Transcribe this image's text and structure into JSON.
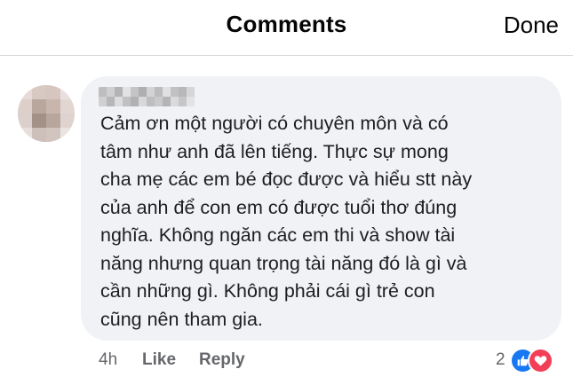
{
  "header": {
    "title": "Comments",
    "done_label": "Done"
  },
  "comment": {
    "text": "Cảm ơn một người có chuyên môn và có\ntâm như anh đã lên tiếng. Thực sự mong\ncha mẹ các em bé đọc được và hiểu stt này\ncủa anh để con em có được tuổi thơ đúng\nnghĩa. Không ngăn các em thi và show tài\nnăng nhưng quan trọng tài năng đó là gì và\ncần những gì. Không phải cái gì trẻ con\ncũng nên tham gia.",
    "time": "4h",
    "like_label": "Like",
    "reply_label": "Reply",
    "reaction_count": "2",
    "reaction_icons": [
      "like-reaction-icon",
      "love-reaction-icon"
    ]
  },
  "colors": {
    "bubble": "#f0f2f5",
    "meta_text": "#65676b",
    "like_blue": "#1877f2",
    "love_red": "#f33e58"
  }
}
